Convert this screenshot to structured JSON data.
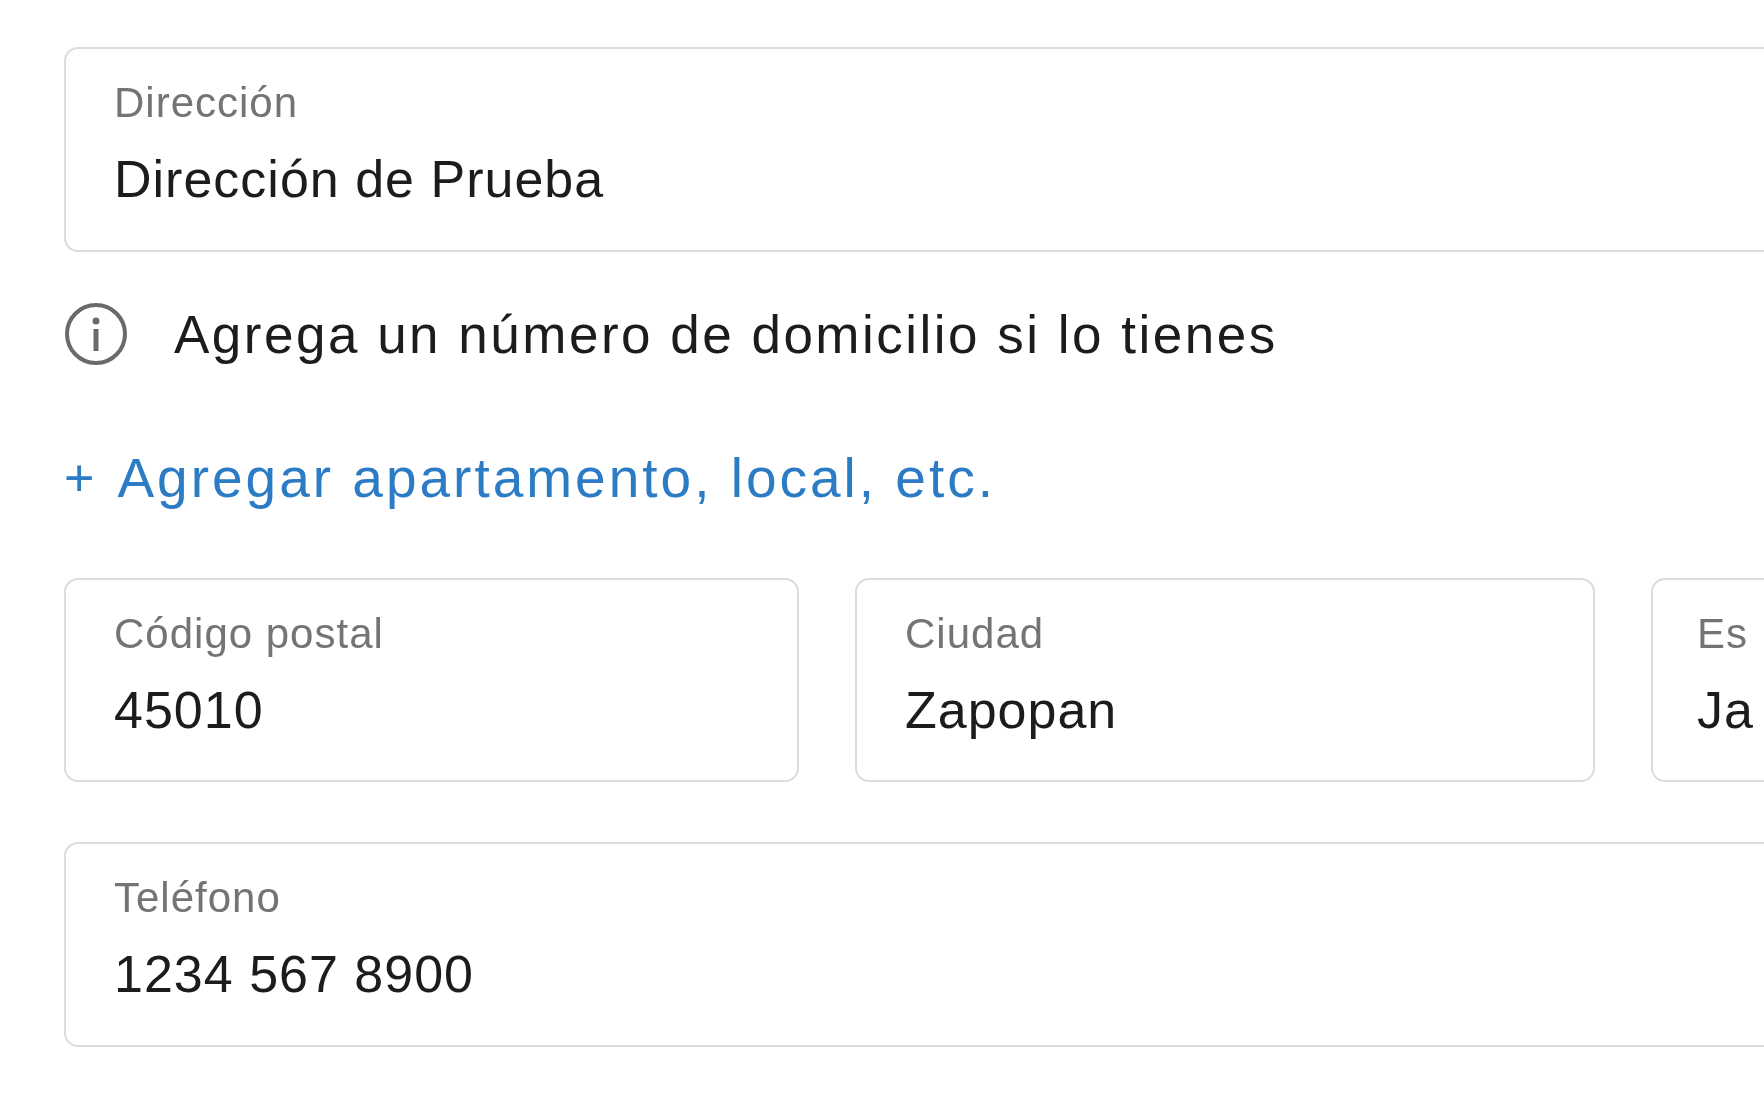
{
  "address": {
    "label": "Dirección",
    "value": "Dirección de Prueba"
  },
  "hint": {
    "text": "Agrega un número de domicilio si lo tienes"
  },
  "add_link": {
    "icon": "+",
    "text": "Agregar apartamento, local, etc."
  },
  "row_fields": [
    {
      "label": "Código postal",
      "value": "45010"
    },
    {
      "label": "Ciudad",
      "value": "Zapopan"
    },
    {
      "label": "Es",
      "value": "Ja"
    }
  ],
  "phone": {
    "label": "Teléfono",
    "value": "1234 567 8900"
  }
}
